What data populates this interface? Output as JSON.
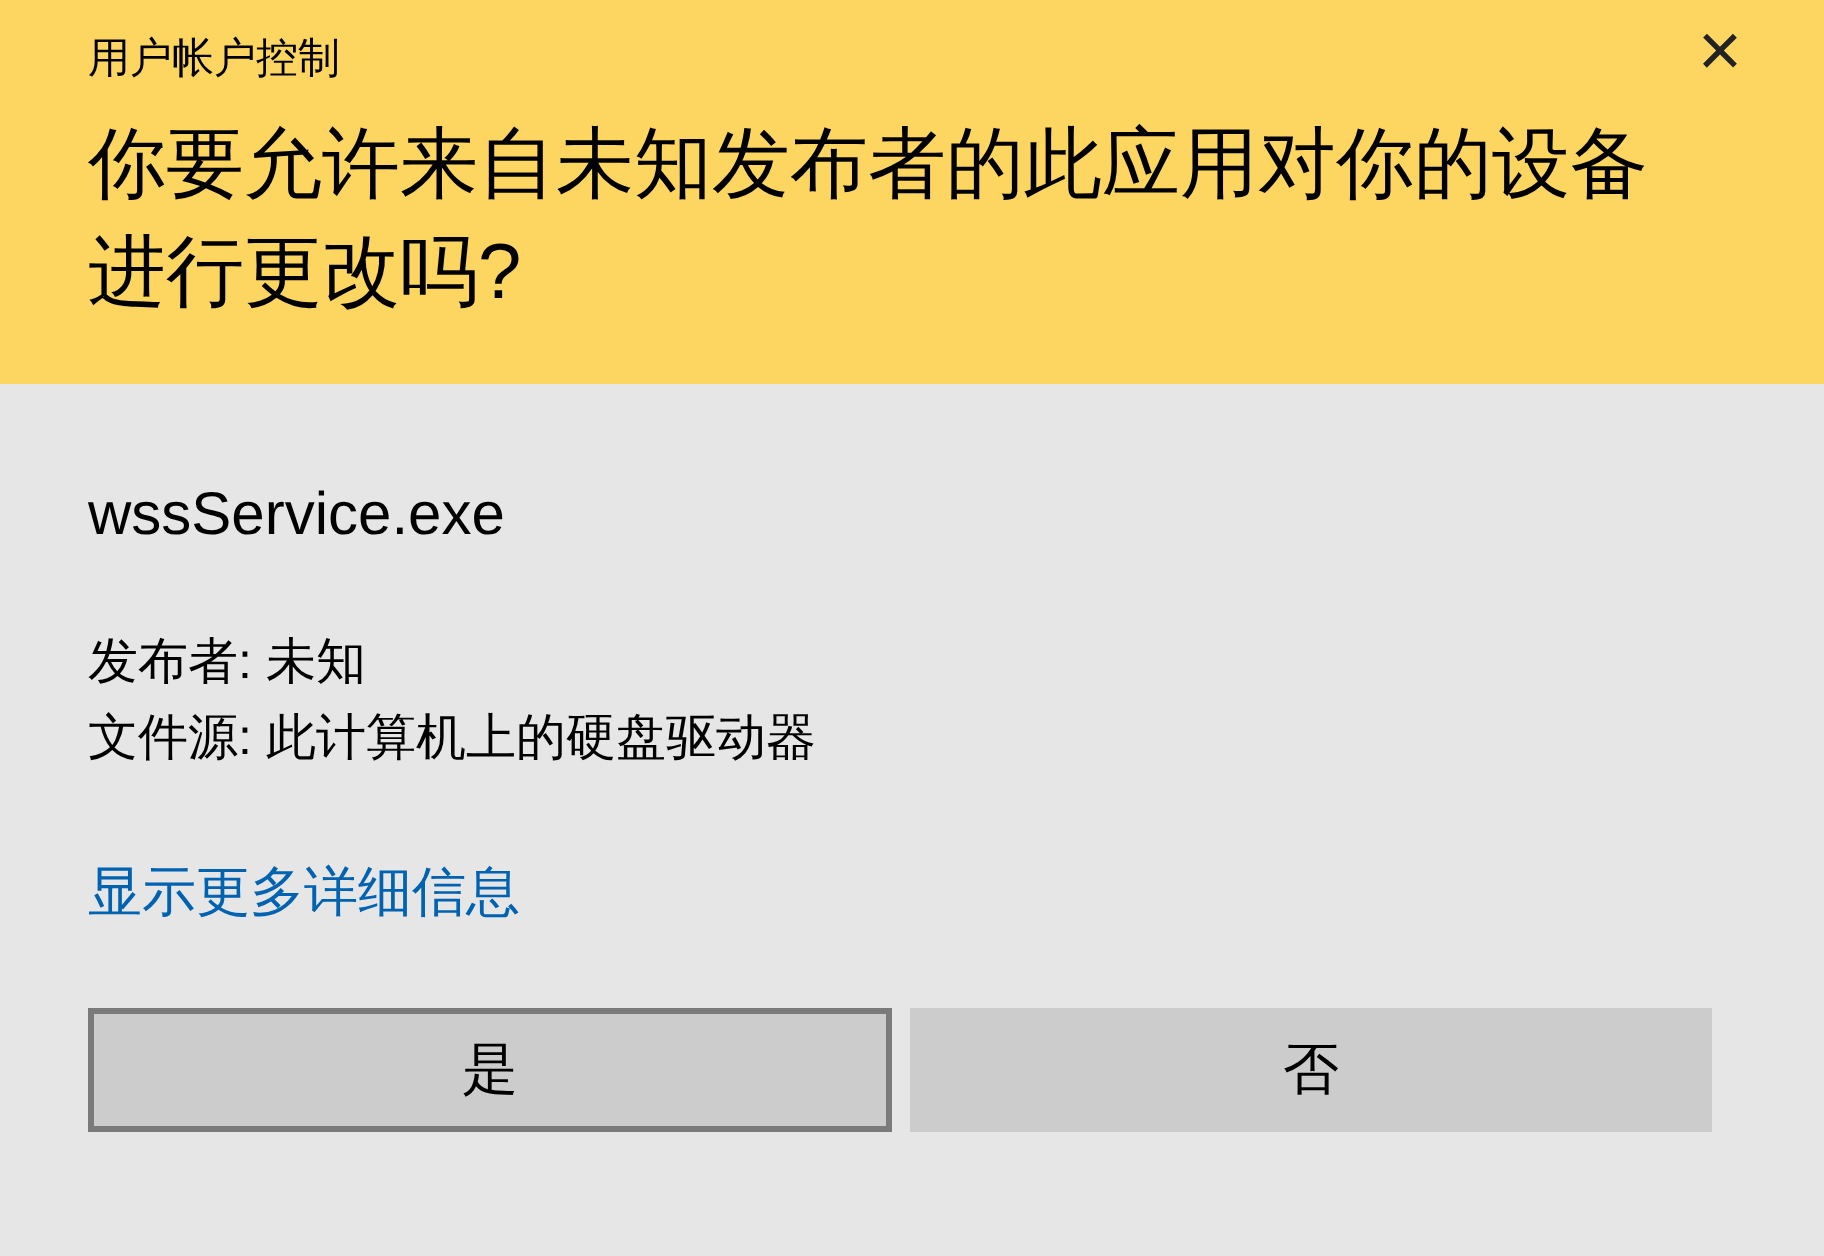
{
  "window": {
    "title": "用户帐户控制",
    "close": "×"
  },
  "question": "你要允许来自未知发布者的此应用对你的设备进行更改吗?",
  "app_name": "wssService.exe",
  "details": [
    {
      "label": "发布者:",
      "value": "未知"
    },
    {
      "label": "文件源:",
      "value": "此计算机上的硬盘驱动器"
    }
  ],
  "more_details_link": "显示更多详细信息",
  "buttons": [
    {
      "label": "是",
      "focused": true
    },
    {
      "label": "否",
      "focused": false
    }
  ]
}
